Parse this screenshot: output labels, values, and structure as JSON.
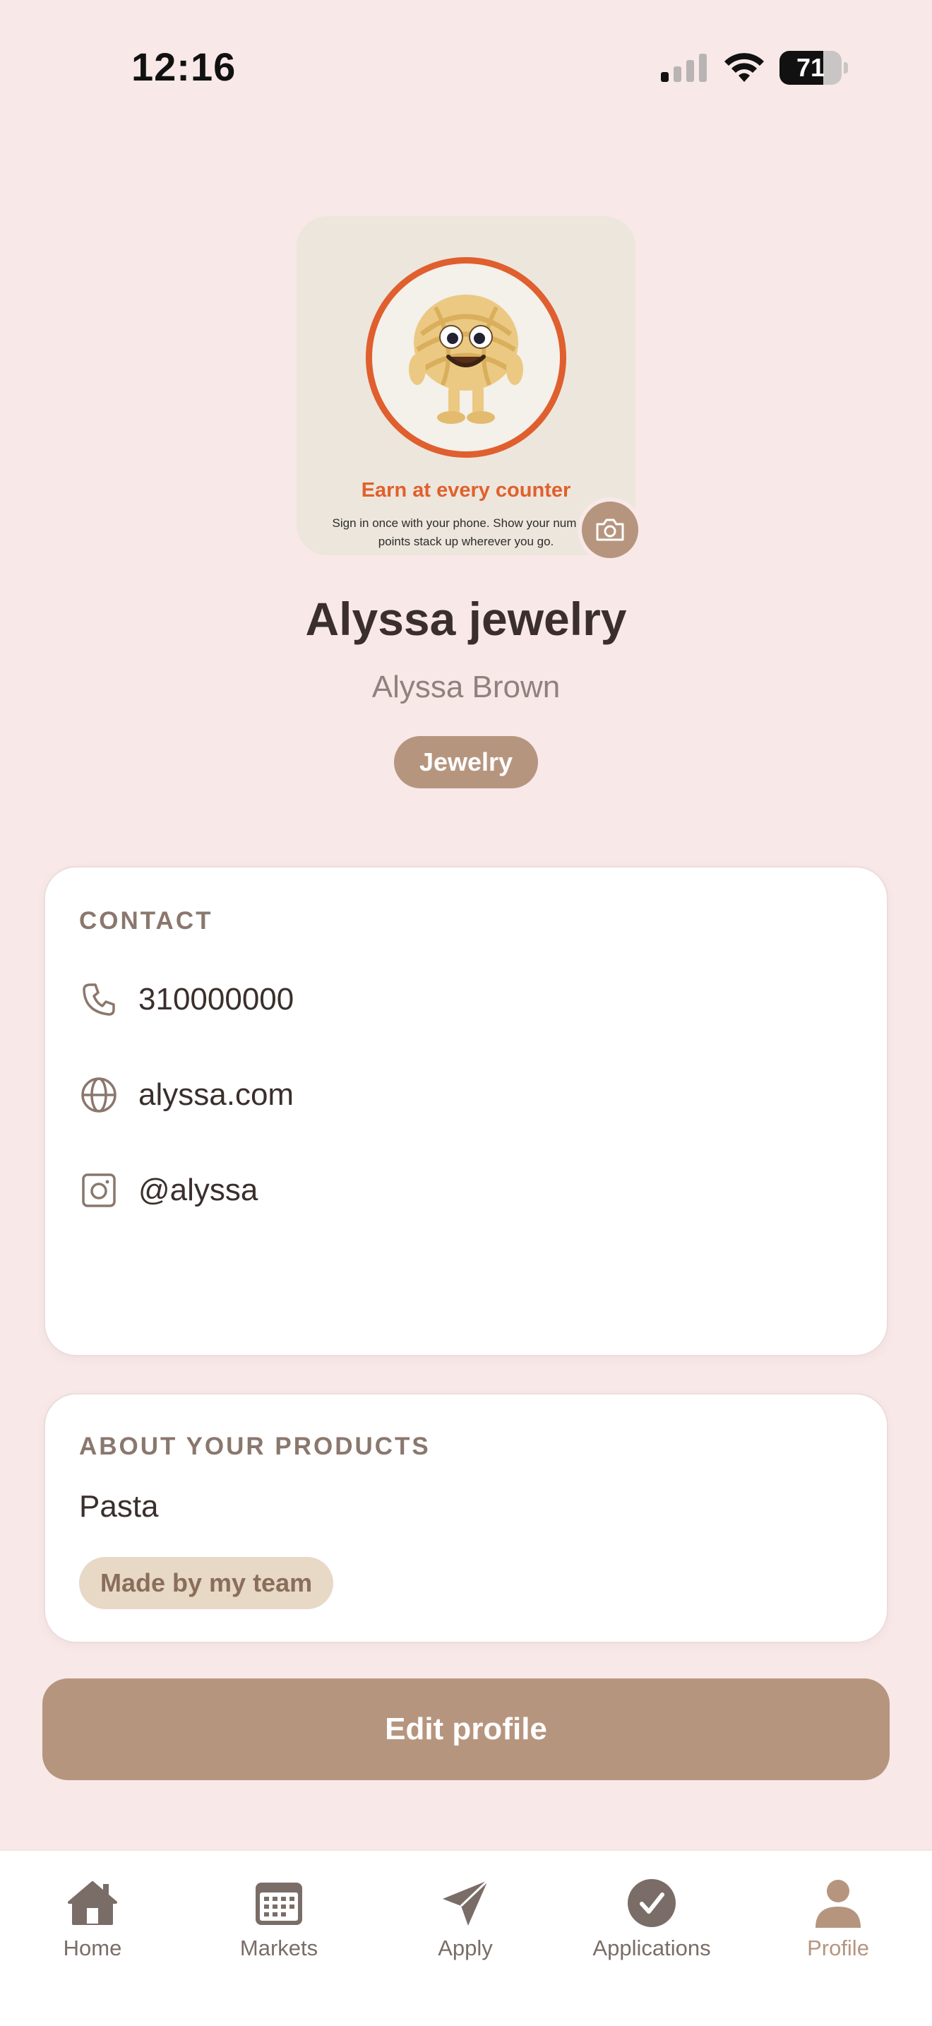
{
  "status_bar": {
    "time": "12:16",
    "battery_level": 71,
    "battery_label": "71"
  },
  "profile": {
    "promo_title": "Earn at every counter",
    "promo_body": "Sign in once with your phone. Show your num and points stack up wherever you go.",
    "business_name": "Alyssa jewelry",
    "owner_name": "Alyssa Brown",
    "category": "Jewelry"
  },
  "contact": {
    "title": "CONTACT",
    "phone": "310000000",
    "website": "alyssa.com",
    "instagram": "@alyssa"
  },
  "about": {
    "title": "ABOUT YOUR PRODUCTS",
    "products": "Pasta",
    "badge": "Made by my team"
  },
  "edit_button_label": "Edit profile",
  "tabs": [
    {
      "label": "Home",
      "icon": "home-icon"
    },
    {
      "label": "Markets",
      "icon": "calendar-icon"
    },
    {
      "label": "Apply",
      "icon": "send-icon"
    },
    {
      "label": "Applications",
      "icon": "check-circle-icon"
    },
    {
      "label": "Profile",
      "icon": "person-icon",
      "active": true
    }
  ],
  "colors": {
    "background": "#f8e8e8",
    "accent": "#b6957f",
    "promo_orange": "#e0602c",
    "text_dark": "#3a2f2c"
  }
}
